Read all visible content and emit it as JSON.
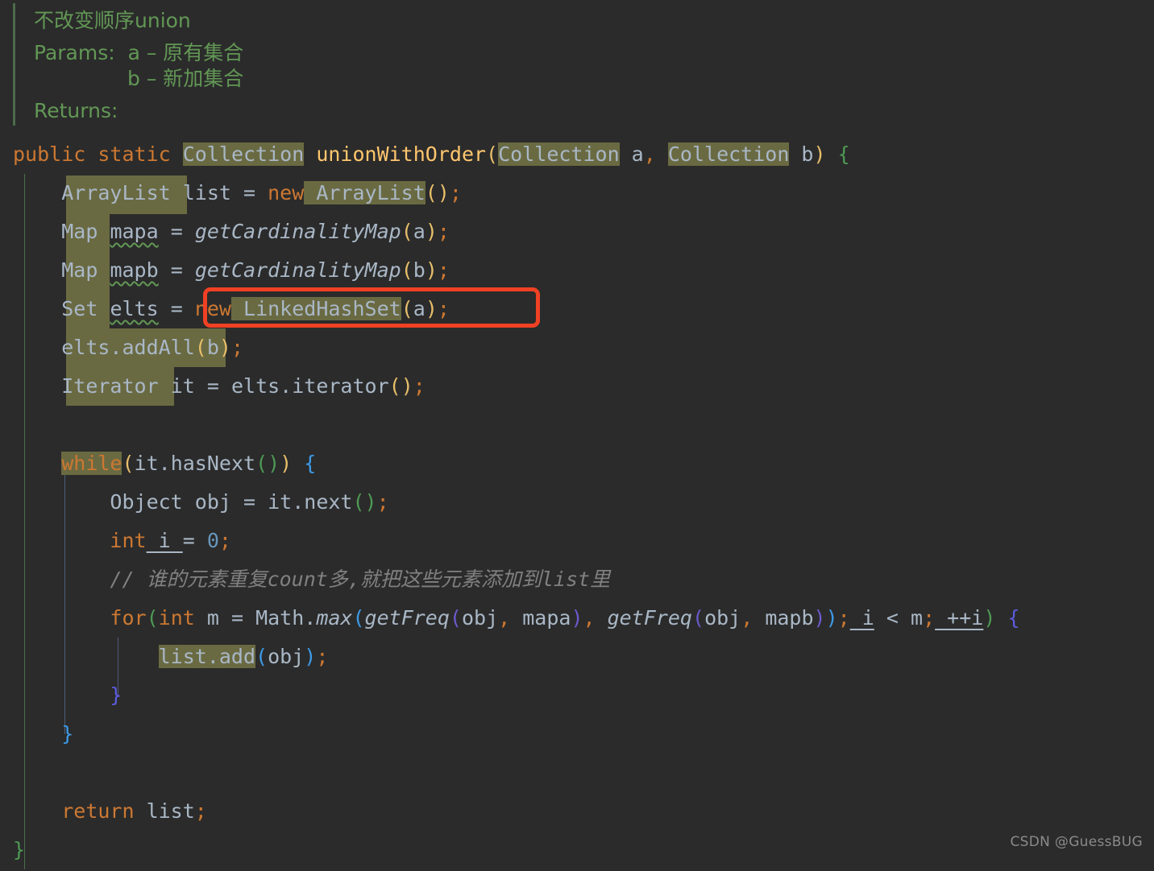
{
  "editor": {
    "background_color": "#2b2b2b",
    "highlight_color": "#6a6a42",
    "annotation_box_color": "#f04124"
  },
  "javadoc": {
    "summary": "不改变顺序union",
    "params_label": "Params:",
    "param_a": "a – 原有集合",
    "param_b": "b – 新加集合",
    "returns_label": "Returns:",
    "color": "#629755"
  },
  "code": {
    "signature": {
      "modifier_public": "public",
      "space1": " ",
      "modifier_static": "static",
      "return_type": "Collection",
      "method_name": "unionWithOrder",
      "paren_open": "(",
      "param1_type": "Collection",
      "param1_name": " a",
      "comma": ",",
      "param2_type": "Collection",
      "param2_name": " b",
      "paren_close": ")",
      "brace_open": "{"
    },
    "line_arraylist": {
      "type": "ArrayList",
      "var": " list ",
      "assign": "= ",
      "kw_new": "new",
      "ctor": " ArrayList",
      "parens": "()",
      "semi": ";"
    },
    "line_mapa": {
      "type": "Map",
      "var": "mapa",
      "assign": " = ",
      "call": "getCardinalityMap",
      "paren_open": "(",
      "arg": "a",
      "paren_close": ")",
      "semi": ";"
    },
    "line_mapb": {
      "type": "Map",
      "var": "mapb",
      "assign": " = ",
      "call": "getCardinalityMap",
      "paren_open": "(",
      "arg": "b",
      "paren_close": ")",
      "semi": ";"
    },
    "line_elts": {
      "type": "Set",
      "var": "elts",
      "assign": " = ",
      "kw_new": "new",
      "ctor": " LinkedHashSet",
      "paren_open": "(",
      "arg": "a",
      "paren_close": ")",
      "semi": ";"
    },
    "line_addall": {
      "expr": "elts.addAll",
      "paren_open": "(",
      "arg": "b",
      "paren_close": ")",
      "semi": ";"
    },
    "line_iterator": {
      "type": "Iterator",
      "var": " it ",
      "assign": "= ",
      "expr": "elts.iterator",
      "parens": "()",
      "semi": ";"
    },
    "line_while": {
      "kw": "while",
      "paren_open": "(",
      "cond": "it.hasNext",
      "inner_parens": "()",
      "paren_close": ")",
      "brace_open": " {"
    },
    "line_object": {
      "type": "Object",
      "var": " obj ",
      "assign": "= ",
      "expr": "it.next",
      "parens": "()",
      "semi": ";"
    },
    "line_int_i": {
      "kw": "int",
      "var": " i ",
      "assign": "= ",
      "value": "0",
      "semi": ";"
    },
    "line_comment": {
      "text": "// 谁的元素重复count多,就把这些元素添加到list里"
    },
    "line_for": {
      "kw_for": "for",
      "paren_open": "(",
      "kw_int": "int",
      "var_m": " m ",
      "assign": "= ",
      "math": "Math.",
      "max": "max",
      "paren_open2": "(",
      "freq1": "getFreq",
      "paren_open3": "(",
      "args1": "obj",
      "comma1": ",",
      "args1b": " mapa",
      "paren_close3": ")",
      "comma2": ",",
      "freq2": " getFreq",
      "paren_open4": "(",
      "args2": "obj",
      "comma3": ",",
      "args2b": " mapb",
      "paren_close4": ")",
      "paren_close2": ")",
      "semi1": ";",
      "cond_i": " i",
      "cond_lt": " < ",
      "cond_m": "m",
      "semi2": ";",
      "incr": " ++i",
      "paren_close": ")",
      "brace_open": " {"
    },
    "line_listadd": {
      "expr": "list.add",
      "paren_open": "(",
      "arg": "obj",
      "paren_close": ")",
      "semi": ";"
    },
    "brace_close_for": "}",
    "brace_close_while": "}",
    "line_return": {
      "kw": "return",
      "var": " list",
      "semi": ";"
    },
    "brace_close_method": "}"
  },
  "watermark": {
    "text": "CSDN @GuessBUG"
  }
}
